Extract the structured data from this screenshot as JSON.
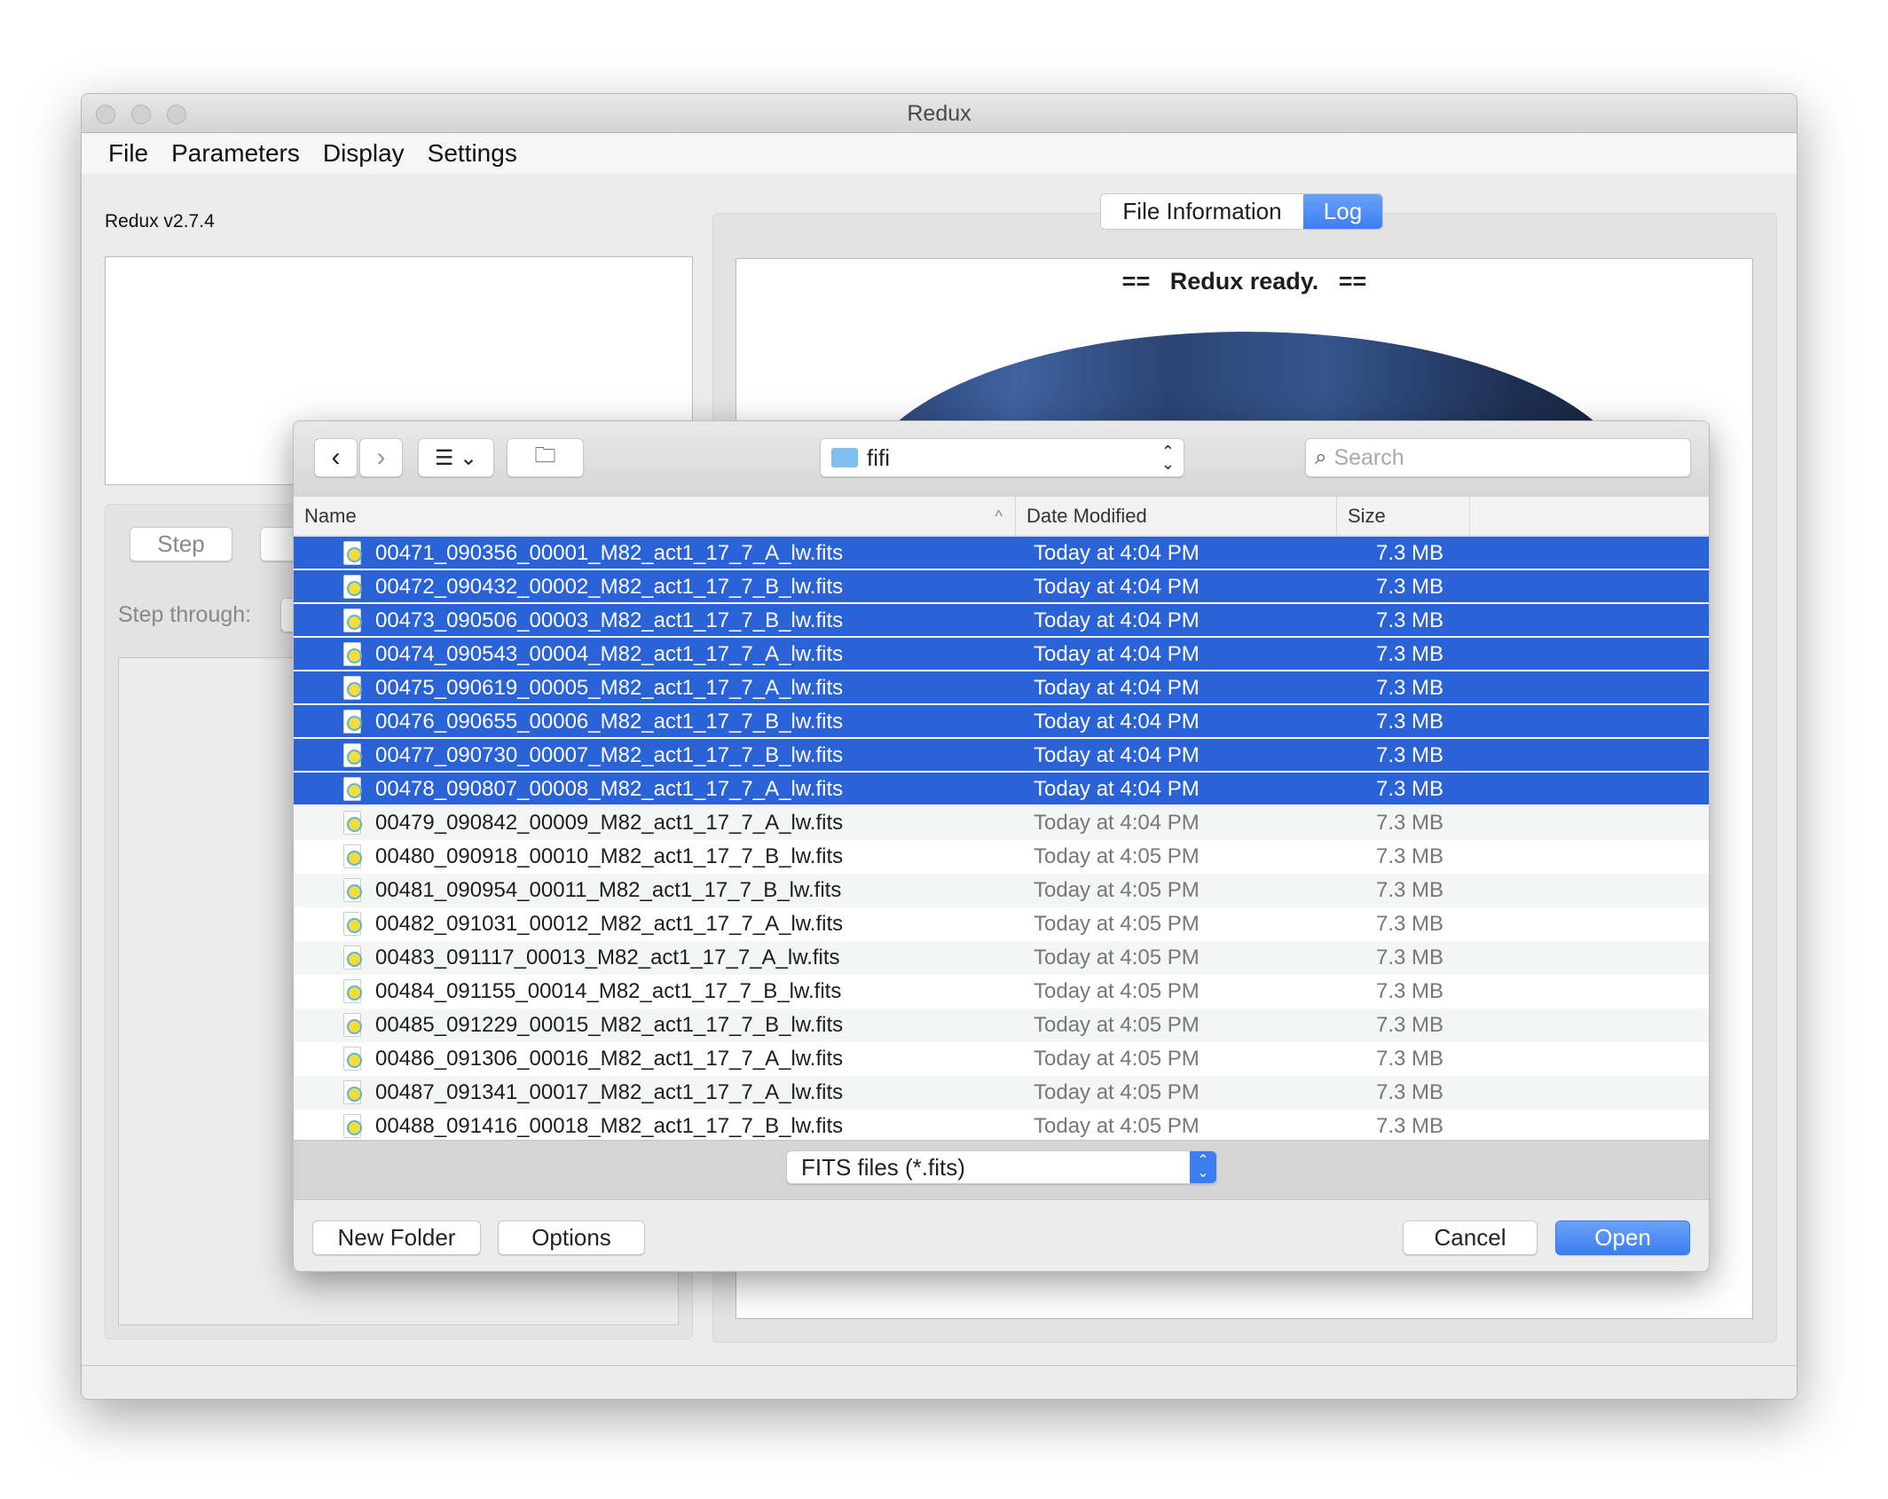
{
  "window": {
    "title": "Redux"
  },
  "menu": [
    "File",
    "Parameters",
    "Display",
    "Settings"
  ],
  "left": {
    "version": "Redux v2.7.4",
    "step_button": "Step",
    "step_through_label": "Step through:"
  },
  "tabs": [
    {
      "label": "File Information",
      "active": false
    },
    {
      "label": "Log",
      "active": true
    }
  ],
  "log": {
    "text": "==   Redux ready.   =="
  },
  "dialog": {
    "location": "fifi",
    "search_placeholder": "Search",
    "columns": [
      "Name",
      "Date Modified",
      "Size"
    ],
    "sort": "Name ascending",
    "files": [
      {
        "name": "00471_090356_00001_M82_act1_17_7_A_lw.fits",
        "date": "Today at 4:04 PM",
        "size": "7.3 MB",
        "selected": true
      },
      {
        "name": "00472_090432_00002_M82_act1_17_7_B_lw.fits",
        "date": "Today at 4:04 PM",
        "size": "7.3 MB",
        "selected": true
      },
      {
        "name": "00473_090506_00003_M82_act1_17_7_B_lw.fits",
        "date": "Today at 4:04 PM",
        "size": "7.3 MB",
        "selected": true
      },
      {
        "name": "00474_090543_00004_M82_act1_17_7_A_lw.fits",
        "date": "Today at 4:04 PM",
        "size": "7.3 MB",
        "selected": true
      },
      {
        "name": "00475_090619_00005_M82_act1_17_7_A_lw.fits",
        "date": "Today at 4:04 PM",
        "size": "7.3 MB",
        "selected": true
      },
      {
        "name": "00476_090655_00006_M82_act1_17_7_B_lw.fits",
        "date": "Today at 4:04 PM",
        "size": "7.3 MB",
        "selected": true
      },
      {
        "name": "00477_090730_00007_M82_act1_17_7_B_lw.fits",
        "date": "Today at 4:04 PM",
        "size": "7.3 MB",
        "selected": true
      },
      {
        "name": "00478_090807_00008_M82_act1_17_7_A_lw.fits",
        "date": "Today at 4:04 PM",
        "size": "7.3 MB",
        "selected": true
      },
      {
        "name": "00479_090842_00009_M82_act1_17_7_A_lw.fits",
        "date": "Today at 4:04 PM",
        "size": "7.3 MB",
        "selected": false
      },
      {
        "name": "00480_090918_00010_M82_act1_17_7_B_lw.fits",
        "date": "Today at 4:05 PM",
        "size": "7.3 MB",
        "selected": false
      },
      {
        "name": "00481_090954_00011_M82_act1_17_7_B_lw.fits",
        "date": "Today at 4:05 PM",
        "size": "7.3 MB",
        "selected": false
      },
      {
        "name": "00482_091031_00012_M82_act1_17_7_A_lw.fits",
        "date": "Today at 4:05 PM",
        "size": "7.3 MB",
        "selected": false
      },
      {
        "name": "00483_091117_00013_M82_act1_17_7_A_lw.fits",
        "date": "Today at 4:05 PM",
        "size": "7.3 MB",
        "selected": false
      },
      {
        "name": "00484_091155_00014_M82_act1_17_7_B_lw.fits",
        "date": "Today at 4:05 PM",
        "size": "7.3 MB",
        "selected": false
      },
      {
        "name": "00485_091229_00015_M82_act1_17_7_B_lw.fits",
        "date": "Today at 4:05 PM",
        "size": "7.3 MB",
        "selected": false
      },
      {
        "name": "00486_091306_00016_M82_act1_17_7_A_lw.fits",
        "date": "Today at 4:05 PM",
        "size": "7.3 MB",
        "selected": false
      },
      {
        "name": "00487_091341_00017_M82_act1_17_7_A_lw.fits",
        "date": "Today at 4:05 PM",
        "size": "7.3 MB",
        "selected": false
      },
      {
        "name": "00488_091416_00018_M82_act1_17_7_B_lw.fits",
        "date": "Today at 4:05 PM",
        "size": "7.3 MB",
        "selected": false
      }
    ],
    "filter": "FITS files (*.fits)",
    "buttons": {
      "new_folder": "New Folder",
      "options": "Options",
      "cancel": "Cancel",
      "open": "Open"
    }
  },
  "colors": {
    "selection": "#2a63d8",
    "accent": "#3b82f6"
  }
}
